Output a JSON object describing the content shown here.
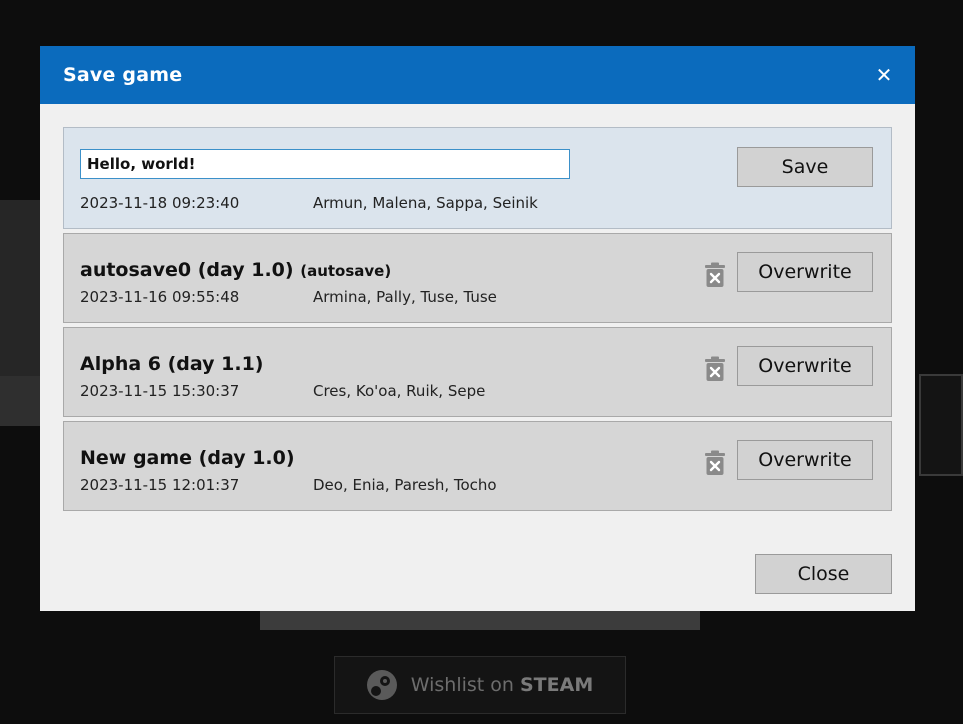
{
  "dialog": {
    "title": "Save game",
    "close_label": "Close"
  },
  "new_save": {
    "name_value": "Hello, world!",
    "date": "2023-11-18 09:23:40",
    "party": "Armun, Malena, Sappa, Seinik",
    "save_label": "Save"
  },
  "slots": [
    {
      "name": "autosave0 (day 1.0)",
      "tag": "(autosave)",
      "date": "2023-11-16 09:55:48",
      "party": "Armina, Pally, Tuse, Tuse",
      "action_label": "Overwrite"
    },
    {
      "name": "Alpha 6 (day 1.1)",
      "tag": "",
      "date": "2023-11-15 15:30:37",
      "party": "Cres, Ko'oa, Ruik, Sepe",
      "action_label": "Overwrite"
    },
    {
      "name": "New game (day 1.0)",
      "tag": "",
      "date": "2023-11-15 12:01:37",
      "party": "Deo, Enia, Paresh, Tocho",
      "action_label": "Overwrite"
    }
  ],
  "background": {
    "wishlist_prefix": "Wishlist on",
    "wishlist_brand": "STEAM"
  },
  "colors": {
    "titlebar": "#0b6bbd",
    "dialog_bg": "#f0f0f0",
    "new_slot_bg": "#dbe4ed",
    "slot_bg": "#d6d6d6",
    "input_border": "#3b90c9"
  },
  "icons": {
    "title_close": "close-icon",
    "delete": "trash-icon",
    "steam": "steam-icon"
  }
}
